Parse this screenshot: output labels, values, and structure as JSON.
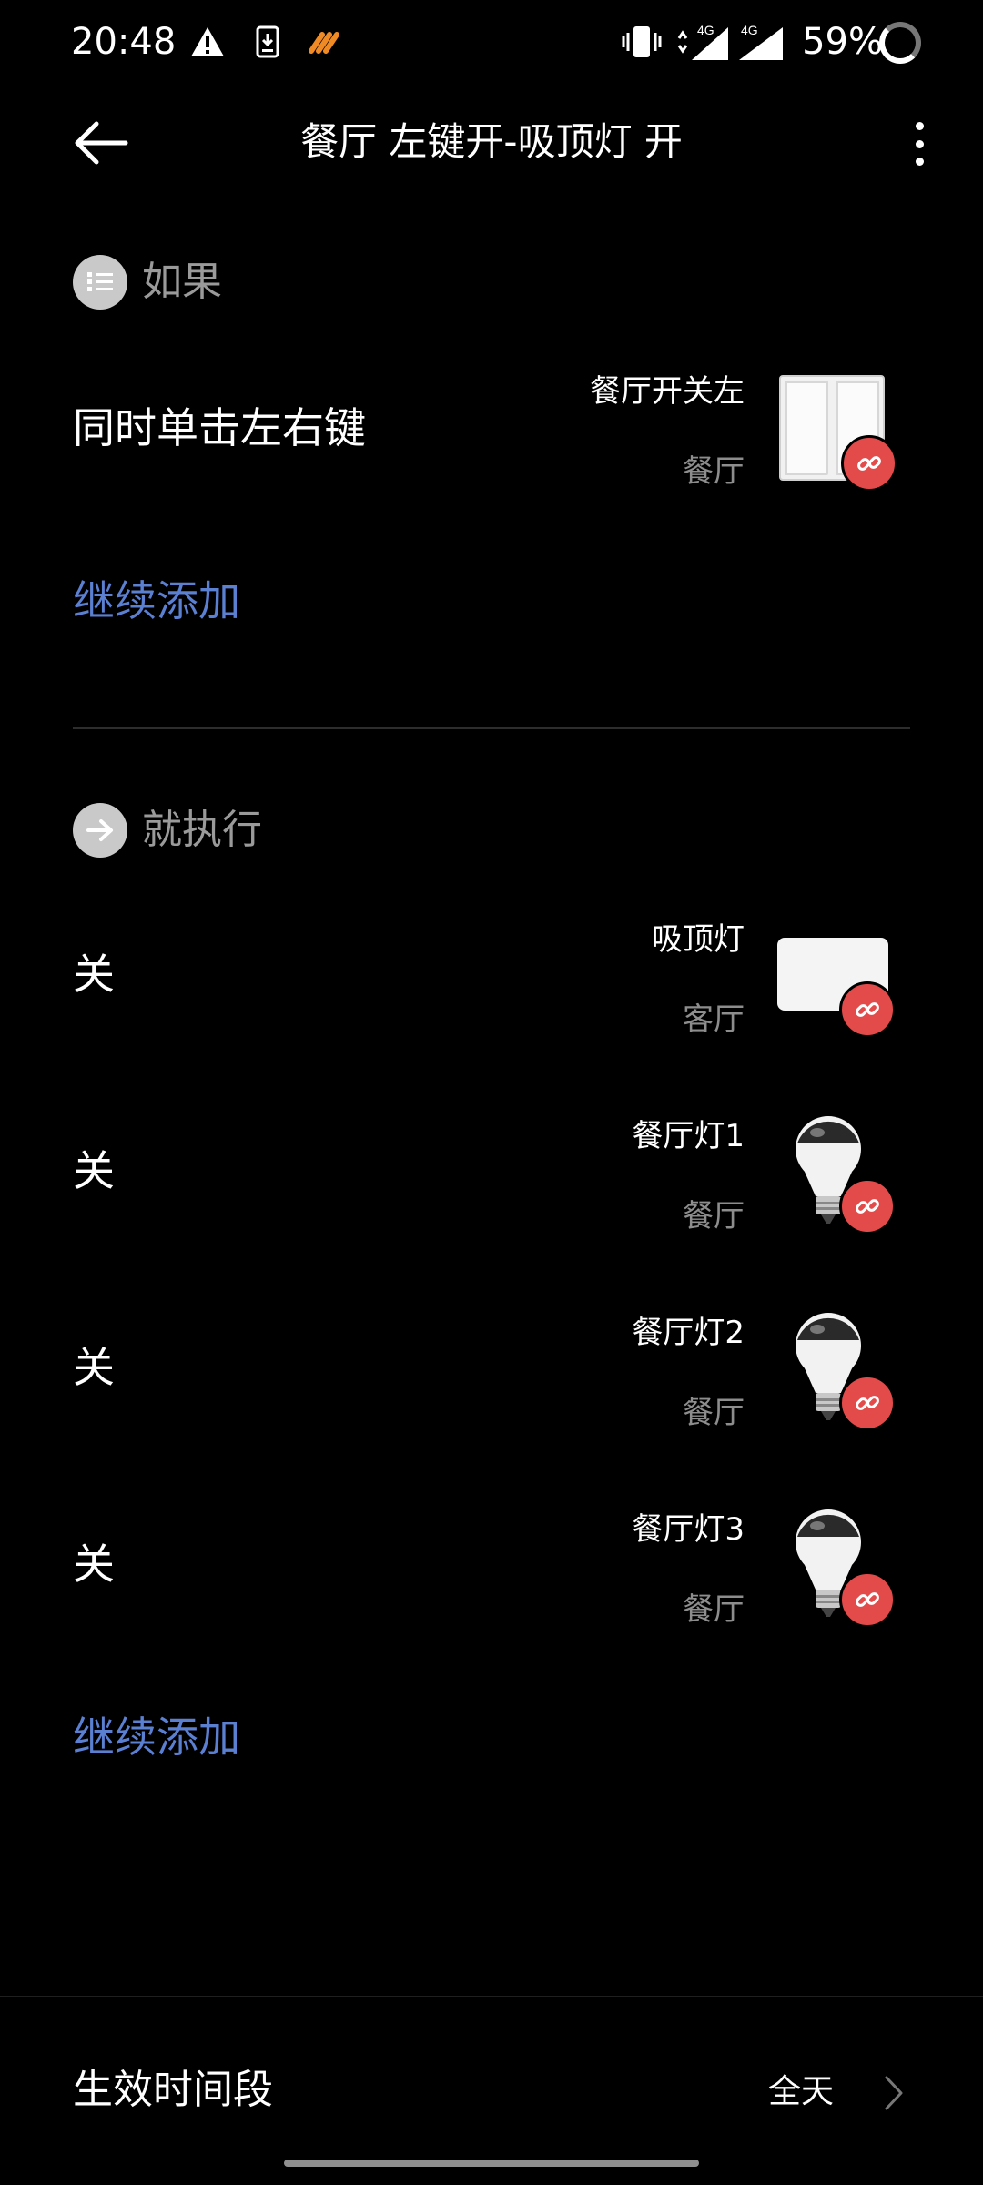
{
  "status_bar": {
    "time": "20:48",
    "battery": "59%",
    "icons": [
      "warning-icon",
      "download-notification-icon",
      "app-notification-icon",
      "vibrate-icon",
      "signal-4g-icon",
      "signal-4g-icon",
      "battery-ring-icon"
    ],
    "network_labels": [
      "4G",
      "4G"
    ]
  },
  "header": {
    "title": "餐厅 左键开-吸顶灯 开",
    "icons": [
      "back-arrow-icon",
      "more-vertical-icon"
    ]
  },
  "if_section": {
    "label": "如果",
    "icon": "list-icon",
    "trigger": {
      "action": "同时单击左右键",
      "device_name": "餐厅开关左",
      "room": "餐厅",
      "device_icon": "double-switch-icon",
      "badge_icon": "unlink-icon"
    },
    "add_label": "继续添加"
  },
  "then_section": {
    "label": "就执行",
    "icon": "arrow-right-icon",
    "actions": [
      {
        "action": "关",
        "device_name": "吸顶灯",
        "room": "客厅",
        "device_icon": "ceiling-light-icon"
      },
      {
        "action": "关",
        "device_name": "餐厅灯1",
        "room": "餐厅",
        "device_icon": "bulb-icon"
      },
      {
        "action": "关",
        "device_name": "餐厅灯2",
        "room": "餐厅",
        "device_icon": "bulb-icon"
      },
      {
        "action": "关",
        "device_name": "餐厅灯3",
        "room": "餐厅",
        "device_icon": "bulb-icon"
      }
    ],
    "add_label": "继续添加"
  },
  "effective_period": {
    "label": "生效时间段",
    "value": "全天",
    "icon": "chevron-right-icon"
  },
  "colors": {
    "background": "#000000",
    "accent_link": "#5b7fd1",
    "badge_red": "#e34a4a",
    "secondary_text": "#8d8d8d"
  }
}
